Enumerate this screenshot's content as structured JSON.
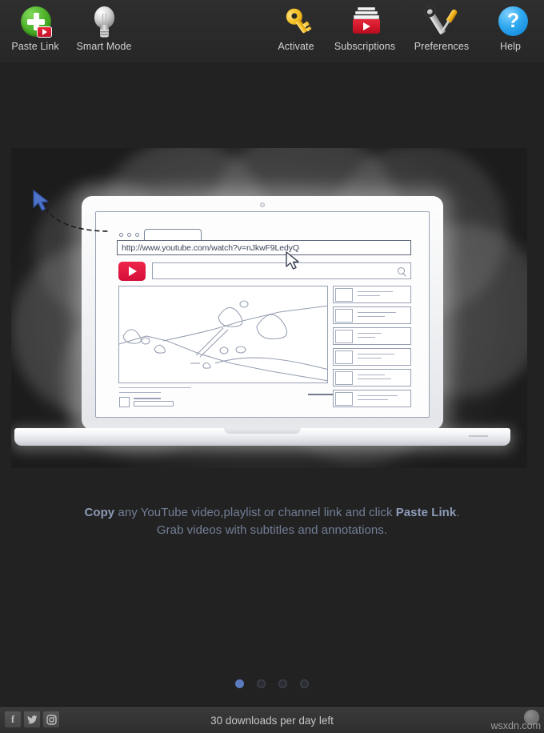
{
  "toolbar": {
    "left_items": [
      {
        "label": "Paste Link",
        "icon": "paste-link-icon"
      },
      {
        "label": "Smart Mode",
        "icon": "light-bulb-icon"
      }
    ],
    "right_items": [
      {
        "label": "Activate",
        "icon": "key-icon"
      },
      {
        "label": "Subscriptions",
        "icon": "subscriptions-tray-icon"
      },
      {
        "label": "Preferences",
        "icon": "wrench-screwdriver-icon"
      },
      {
        "label": "Help",
        "icon": "question-mark-icon"
      }
    ]
  },
  "hero": {
    "browser_url": "http://www.youtube.com/watch?v=nJkwF9LedyQ",
    "youtube_logo": "youtube-play-icon",
    "search_icon": "magnifier-icon"
  },
  "caption": {
    "line1_pre": "Copy",
    "line1_mid": " any YouTube video,playlist or channel link and click ",
    "line1_strong": "Paste Link",
    "line1_end": ".",
    "line2": "Grab videos with subtitles and annotations."
  },
  "pagination": {
    "count": 4,
    "active_index": 0,
    "active_color": "#5b7bbf"
  },
  "statusbar": {
    "social": [
      {
        "name": "facebook-icon",
        "glyph": "f"
      },
      {
        "name": "twitter-icon",
        "glyph": "ᴗ"
      },
      {
        "name": "instagram-icon",
        "glyph": "◉"
      }
    ],
    "status_text": "30 downloads per day left",
    "watermark": "wsxdn.com"
  },
  "colors": {
    "background": "#222222",
    "toolbar": "#2b2b2b",
    "accent_blue": "#5b7bbf",
    "youtube_red": "#d3103a",
    "green": "#4caf28"
  }
}
